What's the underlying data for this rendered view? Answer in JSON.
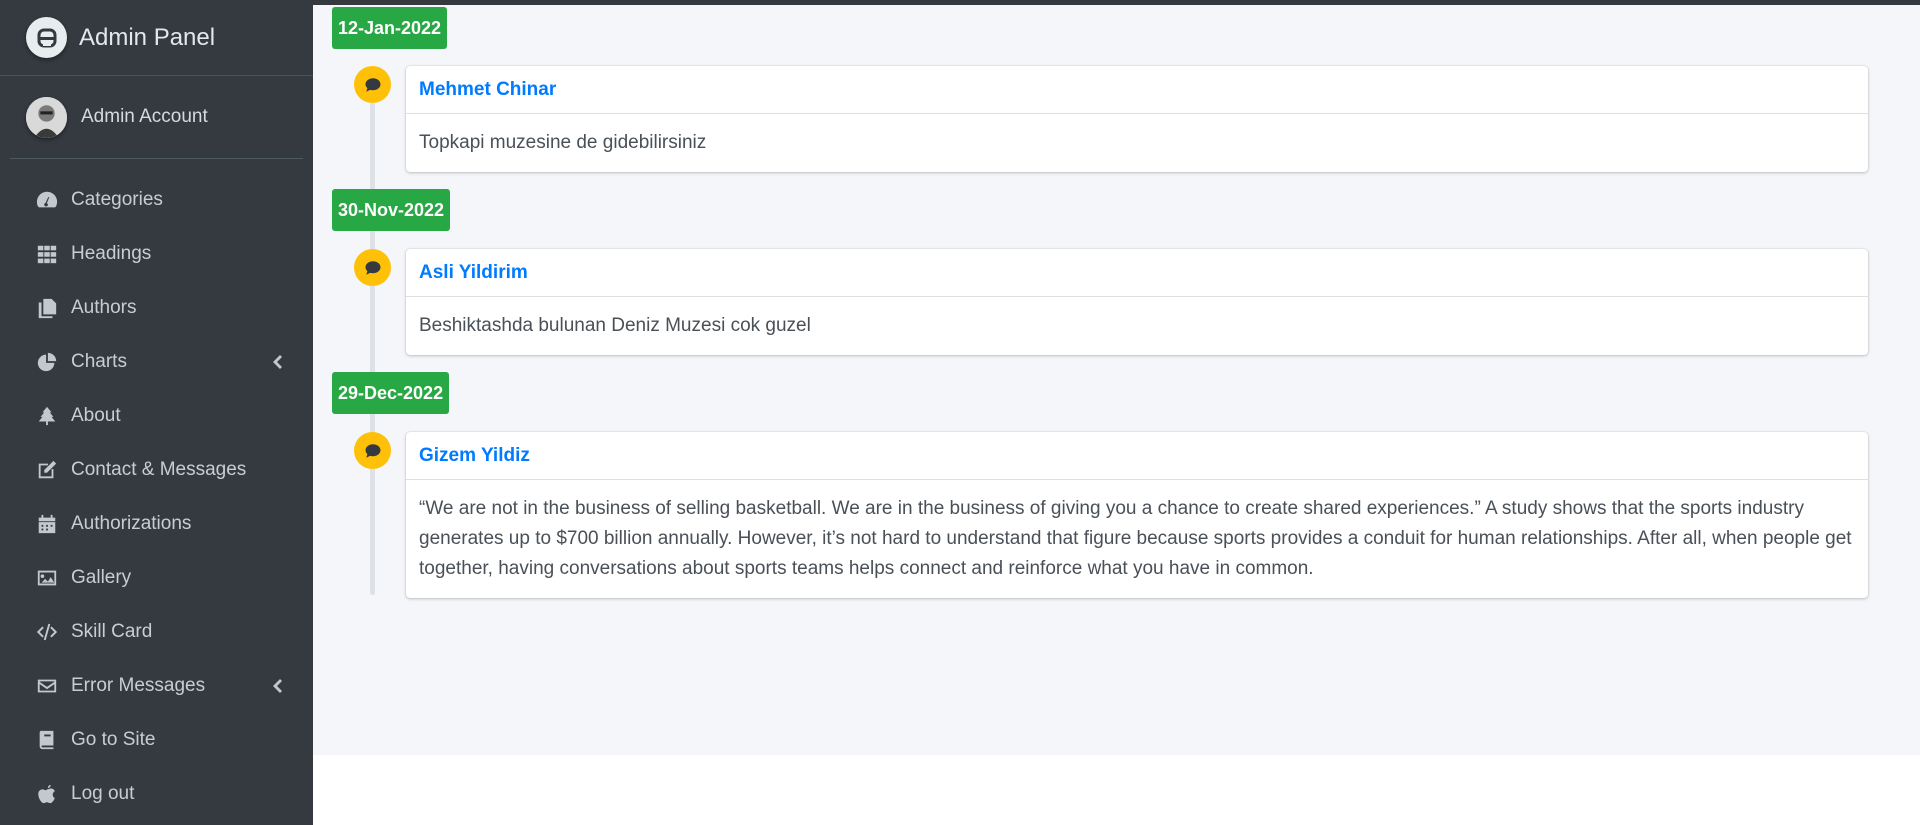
{
  "brand": {
    "title": "Admin Panel",
    "logo_icon": "admin-logo-icon"
  },
  "user": {
    "name": "Admin Account"
  },
  "sidebar": {
    "items": [
      {
        "label": "Categories",
        "icon": "tachometer-icon"
      },
      {
        "label": "Headings",
        "icon": "grid-icon"
      },
      {
        "label": "Authors",
        "icon": "copy-icon"
      },
      {
        "label": "Charts",
        "icon": "chart-pie-icon",
        "has_submenu": true
      },
      {
        "label": "About",
        "icon": "tree-icon"
      },
      {
        "label": "Contact & Messages",
        "icon": "edit-icon"
      },
      {
        "label": "Authorizations",
        "icon": "calendar-icon"
      },
      {
        "label": "Gallery",
        "icon": "image-icon"
      },
      {
        "label": "Skill Card",
        "icon": "code-icon"
      },
      {
        "label": "Error Messages",
        "icon": "envelope-icon",
        "has_submenu": true
      },
      {
        "label": "Go to Site",
        "icon": "book-icon"
      },
      {
        "label": "Log out",
        "icon": "apple-icon"
      }
    ]
  },
  "timeline": {
    "entries": [
      {
        "date": "12-Jan-2022",
        "author": "Mehmet Chinar",
        "message": "Topkapi muzesine de gidebilirsiniz"
      },
      {
        "date": "30-Nov-2022",
        "author": "Asli Yildirim",
        "message": "Beshiktashda bulunan Deniz Muzesi cok guzel"
      },
      {
        "date": "29-Dec-2022",
        "author": "Gizem Yildiz",
        "message": "“We are not in the business of selling basketball. We are in the business of giving you a chance to create shared experiences.” A study shows that the sports industry generates up to $700 billion annually. However, it’s not hard to understand that figure because sports provides a conduit for human relationships. After all, when people get together, having conversations about sports teams helps connect and reinforce what you have in common."
      }
    ]
  },
  "colors": {
    "sidebar_bg": "#343a40",
    "content_bg": "#f4f6f9",
    "date_badge": "#28a745",
    "timeline_icon": "#ffc107",
    "author_link": "#007bff"
  }
}
